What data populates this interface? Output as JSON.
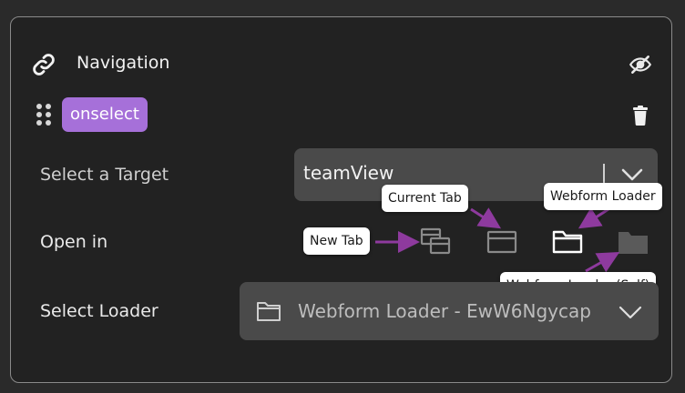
{
  "header": {
    "title": "Navigation"
  },
  "event": {
    "badge": "onselect"
  },
  "fields": {
    "target_label": "Select a Target",
    "target_value": "teamView",
    "open_in_label": "Open in",
    "loader_label": "Select Loader",
    "loader_value": "Webform Loader - EwW6Ngycap"
  },
  "tooltips": {
    "new_tab": "New Tab",
    "current_tab": "Current Tab",
    "webform_loader": "Webform Loader",
    "webform_loader_self": "Webform Loader (Self)"
  },
  "colors": {
    "accent": "#a670d9",
    "annotation_arrow": "#8e3a9e"
  },
  "icons": [
    "link-icon",
    "eye-off-icon",
    "drag-handle-icon",
    "trash-icon",
    "chevron-down-icon",
    "new-tab-icon",
    "current-tab-icon",
    "folder-icon",
    "folder-filled-icon"
  ]
}
